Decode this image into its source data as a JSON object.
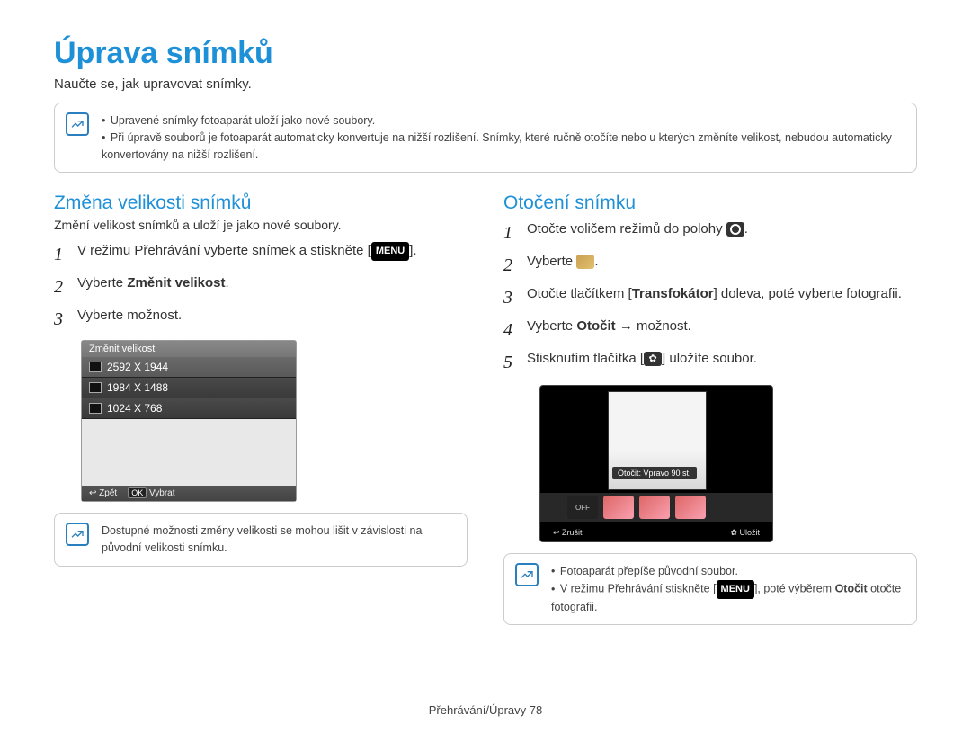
{
  "title": "Úprava snímků",
  "subtitle": "Naučte se, jak upravovat snímky.",
  "intro_notes": [
    "Upravené snímky fotoaparát uloží jako nové soubory.",
    "Při úpravě souborů je fotoaparát automaticky konvertuje na nižší rozlišení. Snímky, které ručně otočíte nebo u kterých změníte velikost, nebudou automaticky konvertovány na nižší rozlišení."
  ],
  "resize": {
    "heading": "Změna velikosti snímků",
    "sub": "Změní velikost snímků a uloží je jako nové soubory.",
    "step1_a": "V režimu Přehrávání vyberte snímek a stiskněte [",
    "step1_menu": "MENU",
    "step1_b": "].",
    "step2_a": "Vyberte ",
    "step2_b": "Změnit velikost",
    "step2_c": ".",
    "step3": "Vyberte možnost.",
    "menu": {
      "title": "Změnit velikost",
      "opts": [
        "2592 X 1944",
        "1984 X 1488",
        "1024 X 768"
      ],
      "back": "Zpět",
      "ok": "OK",
      "select": "Vybrat"
    },
    "note": "Dostupné možnosti změny velikosti se mohou lišit v závislosti na původní velikosti snímku."
  },
  "rotate": {
    "heading": "Otočení snímku",
    "step1_a": "Otočte voličem režimů do polohy ",
    "step1_b": ".",
    "step2_a": "Vyberte ",
    "step2_b": ".",
    "step3_a": "Otočte tlačítkem [",
    "step3_b": "Transfokátor",
    "step3_c": "] doleva, poté vyberte fotografii.",
    "step4_a": "Vyberte ",
    "step4_b": "Otočit",
    "step4_c": " → možnost.",
    "step5_a": "Stisknutím tlačítka [",
    "step5_b": "] uložíte soubor.",
    "shot_tip": "Otočit: Vpravo 90 st.",
    "shot_off": "OFF",
    "shot_cancel": "Zrušit",
    "shot_save": "Uložit",
    "notes": [
      "Fotoaparát přepíše původní soubor.",
      "V režimu Přehrávání stiskněte [MENU], poté výběrem Otočit otočte fotografii."
    ],
    "note2_a": "V režimu Přehrávání stiskněte [",
    "note2_menu": "MENU",
    "note2_b": "], poté výběrem ",
    "note2_c": "Otočit",
    "note2_d": " otočte fotografii."
  },
  "footer": "Přehrávání/Úpravy  78"
}
